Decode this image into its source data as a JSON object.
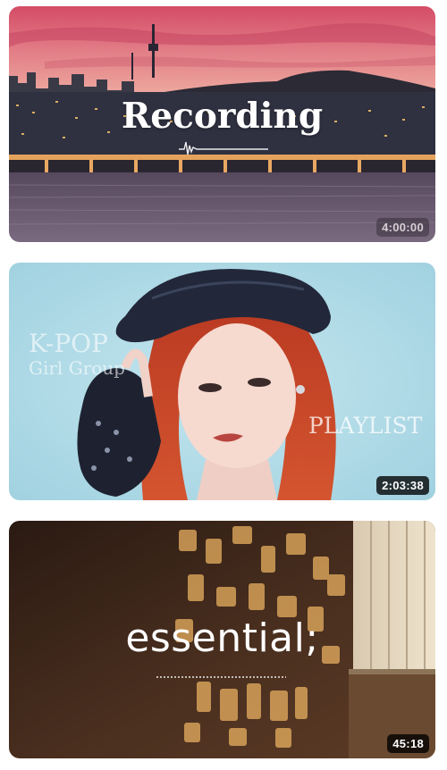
{
  "videos": [
    {
      "overlay_title": "Recording",
      "duration": "4:00:00"
    },
    {
      "overlay_line1": "K-POP",
      "overlay_line2": "Girl Group",
      "overlay_line3": "PLAYLIST",
      "duration": "2:03:38"
    },
    {
      "overlay_title": "essential;",
      "duration": "45:18"
    }
  ],
  "colors": {
    "badge_bg": "#000000",
    "badge_text": "#ffffff",
    "sky_top": "#d9576a",
    "sky_mid": "#e5868d",
    "river": "#6d5a6e",
    "pop_bg": "#a9d6e4",
    "hair": "#c9442a",
    "essential_dark": "#3a2418",
    "essential_light": "#e8b060"
  }
}
